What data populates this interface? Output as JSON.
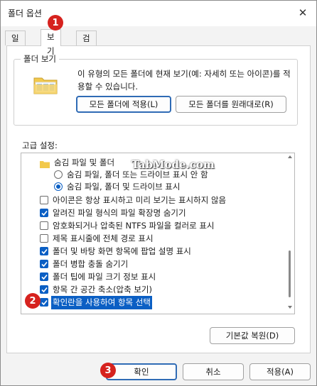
{
  "window": {
    "title": "폴더 옵션"
  },
  "tabs": [
    {
      "label": "일반",
      "active": false
    },
    {
      "label": "보기",
      "active": true
    },
    {
      "label": "검색",
      "active": false
    }
  ],
  "folder_views": {
    "legend": "폴더 보기",
    "description": "이 유형의 모든 폴더에 현재 보기(예: 자세히 또는 아이콘)를 적용할 수 있습니다.",
    "apply_button": "모든 폴더에 적용(L)",
    "reset_button": "모든 폴더를 원래대로(R)"
  },
  "advanced": {
    "label": "고급 설정:",
    "items": [
      {
        "type": "folder",
        "label": "숨김 파일 및 폴더"
      },
      {
        "type": "radio",
        "label": "숨김 파일, 폴더 또는 드라이브 표시 안 함",
        "checked": false
      },
      {
        "type": "radio",
        "label": "숨김 파일, 폴더 및 드라이브 표시",
        "checked": true
      },
      {
        "type": "checkbox",
        "label": "아이콘은 항상 표시하고 미리 보기는 표시하지 않음",
        "checked": false
      },
      {
        "type": "checkbox",
        "label": "알려진 파일 형식의 파일 확장명 숨기기",
        "checked": true
      },
      {
        "type": "checkbox",
        "label": "암호화되거나 압축된 NTFS 파일을 컬러로 표시",
        "checked": false
      },
      {
        "type": "checkbox",
        "label": "제목 표시줄에 전체 경로 표시",
        "checked": false
      },
      {
        "type": "checkbox",
        "label": "폴더 및 바탕 화면 항목에 팝업 설명 표시",
        "checked": true
      },
      {
        "type": "checkbox",
        "label": "폴더 병합 충돌 숨기기",
        "checked": true
      },
      {
        "type": "checkbox",
        "label": "폴더 팁에 파일 크기 정보 표시",
        "checked": true
      },
      {
        "type": "checkbox",
        "label": "항목 간 공간 축소(압축 보기)",
        "checked": true
      },
      {
        "type": "checkbox",
        "label": "확인란을 사용하여 항목 선택",
        "checked": true,
        "selected": true
      }
    ],
    "restore_button": "기본값 복원(D)"
  },
  "footer": {
    "ok": "확인",
    "cancel": "취소",
    "apply": "적용(A)"
  },
  "markers": [
    "1",
    "2",
    "3"
  ],
  "watermark": "TabMode.com",
  "colors": {
    "accent": "#0b5fc4",
    "marker": "#d6221e"
  }
}
